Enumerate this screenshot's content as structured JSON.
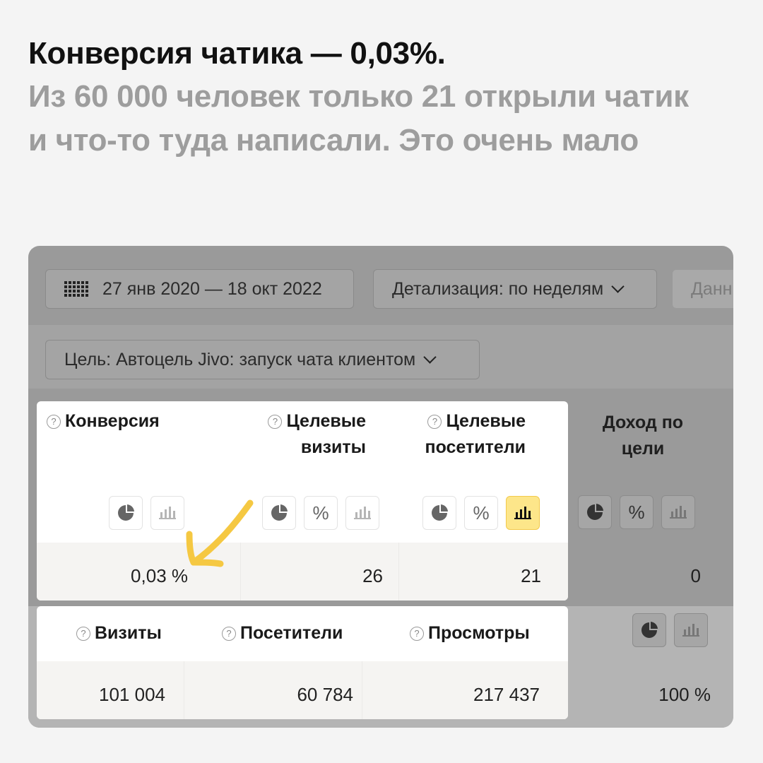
{
  "headline": {
    "title": "Конверсия чатика — 0,03%.",
    "subtitle": "Из 60 000 человек только 21 открыли чатик и что-то туда написали. Это очень мало"
  },
  "toolbar": {
    "date_range": "27 янв 2020 — 18 окт 2022",
    "detail": "Детализация: по неделям",
    "data_label": "Данн",
    "goal": "Цель: Автоцель Jivo: запуск чата клиентом"
  },
  "goal_metrics": {
    "columns": [
      {
        "label": "Конверсия",
        "value": "0,03 %"
      },
      {
        "label": "Целевые визиты",
        "label_lines": [
          "Целевые",
          "визиты"
        ],
        "value": "26"
      },
      {
        "label": "Целевые посетители",
        "label_lines": [
          "Целевые",
          "посетители"
        ],
        "value": "21"
      },
      {
        "label": "Доход по цели",
        "label_lines": [
          "Доход по",
          "цели"
        ],
        "value": "0"
      }
    ],
    "help_mark": "?"
  },
  "summary_metrics": {
    "columns": [
      {
        "label": "Визиты",
        "value": "101 004"
      },
      {
        "label": "Посетители",
        "value": "60 784"
      },
      {
        "label": "Просмотры",
        "value": "217 437"
      }
    ],
    "extra_value": "100 %"
  },
  "icons": {
    "pie": "pie-chart-icon",
    "percent": "percent-icon",
    "bars": "bar-chart-icon",
    "percent_glyph": "%"
  },
  "colors": {
    "active_toggle": "#fde68a",
    "annotation_arrow": "#f5c842"
  }
}
